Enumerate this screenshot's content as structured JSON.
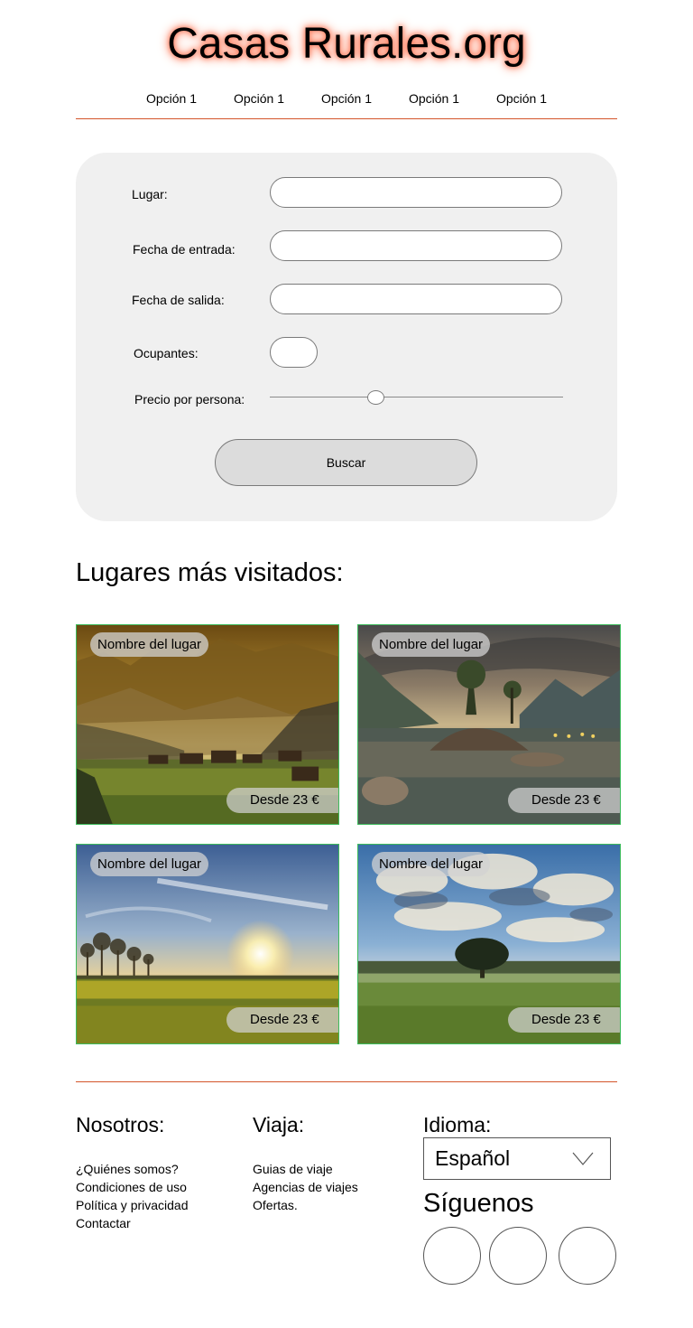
{
  "header": {
    "title": "Casas Rurales.org",
    "nav": [
      "Opción 1",
      "Opción 1",
      "Opción 1",
      "Opción 1",
      "Opción 1"
    ]
  },
  "search": {
    "place_label": "Lugar:",
    "checkin_label": "Fecha de entrada:",
    "checkout_label": "Fecha de salida:",
    "guests_label": "Ocupantes:",
    "price_label": "Precio por persona:",
    "price_level": 0.36,
    "button_label": "Buscar"
  },
  "popular": {
    "title": "Lugares más visitados:",
    "cards": [
      {
        "name": "Nombre del lugar",
        "price": "Desde 23 €",
        "scene": "mountain-valley-sunset"
      },
      {
        "name": "Nombre del lugar",
        "price": "Desde 23 €",
        "scene": "lake-island-trees"
      },
      {
        "name": "Nombre del lugar",
        "price": "Desde 23 €",
        "scene": "sunset-flower-field"
      },
      {
        "name": "Nombre del lugar",
        "price": "Desde 23 €",
        "scene": "lone-tree-meadow"
      }
    ]
  },
  "footer": {
    "about_title": "Nosotros:",
    "about_links": [
      "¿Quiénes somos?",
      "Condiciones de uso",
      "Política y privacidad",
      "Contactar"
    ],
    "travel_title": "Viaja:",
    "travel_links": [
      "Guias de viaje",
      "Agencias de viajes",
      "Ofertas."
    ],
    "language_title": "Idioma:",
    "language_value": "Español",
    "follow_title": "Síguenos"
  },
  "colors": {
    "accent_line": "#d4552a",
    "title_glow": "#ff6b4a",
    "card_border": "#3dbb5c",
    "panel_bg": "#f0f0f0"
  }
}
